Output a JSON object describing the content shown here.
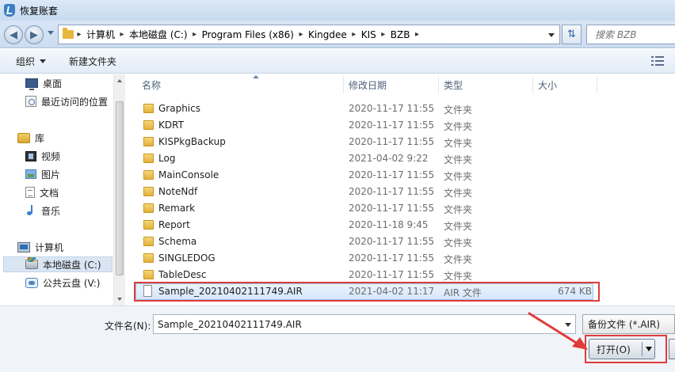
{
  "window": {
    "title": "恢复账套"
  },
  "address": {
    "crumbs": [
      "计算机",
      "本地磁盘 (C:)",
      "Program Files (x86)",
      "Kingdee",
      "KIS",
      "BZB"
    ],
    "search_placeholder": "搜索 BZB"
  },
  "toolbar": {
    "organize": "组织",
    "new_folder": "新建文件夹"
  },
  "nav": {
    "desktop": "桌面",
    "recent": "最近访问的位置",
    "libraries": "库",
    "videos": "视频",
    "pictures": "图片",
    "documents": "文档",
    "music": "音乐",
    "computer": "计算机",
    "local_disk": "本地磁盘 (C:)",
    "cloud_disk": "公共云盘 (V:)"
  },
  "columns": {
    "name": "名称",
    "date": "修改日期",
    "type": "类型",
    "size": "大小"
  },
  "files": [
    {
      "name": "Graphics",
      "date": "2020-11-17 11:55",
      "type": "文件夹",
      "size": ""
    },
    {
      "name": "KDRT",
      "date": "2020-11-17 11:55",
      "type": "文件夹",
      "size": ""
    },
    {
      "name": "KISPkgBackup",
      "date": "2020-11-17 11:55",
      "type": "文件夹",
      "size": ""
    },
    {
      "name": "Log",
      "date": "2021-04-02 9:22",
      "type": "文件夹",
      "size": ""
    },
    {
      "name": "MainConsole",
      "date": "2020-11-17 11:55",
      "type": "文件夹",
      "size": ""
    },
    {
      "name": "NoteNdf",
      "date": "2020-11-17 11:55",
      "type": "文件夹",
      "size": ""
    },
    {
      "name": "Remark",
      "date": "2020-11-17 11:55",
      "type": "文件夹",
      "size": ""
    },
    {
      "name": "Report",
      "date": "2020-11-18 9:45",
      "type": "文件夹",
      "size": ""
    },
    {
      "name": "Schema",
      "date": "2020-11-17 11:55",
      "type": "文件夹",
      "size": ""
    },
    {
      "name": "SINGLEDOG",
      "date": "2020-11-17 11:55",
      "type": "文件夹",
      "size": ""
    },
    {
      "name": "TableDesc",
      "date": "2020-11-17 11:55",
      "type": "文件夹",
      "size": ""
    },
    {
      "name": "Sample_20210402111749.AIR",
      "date": "2021-04-02 11:17",
      "type": "AIR 文件",
      "size": "674 KB"
    }
  ],
  "bottom": {
    "filename_label": "文件名(N):",
    "filename_value": "Sample_20210402111749.AIR",
    "filetype_value": "备份文件 (*.AIR)",
    "open_label": "打开(O)"
  },
  "colors": {
    "highlight": "#e03b3b",
    "selection": "#d6e7fa"
  }
}
